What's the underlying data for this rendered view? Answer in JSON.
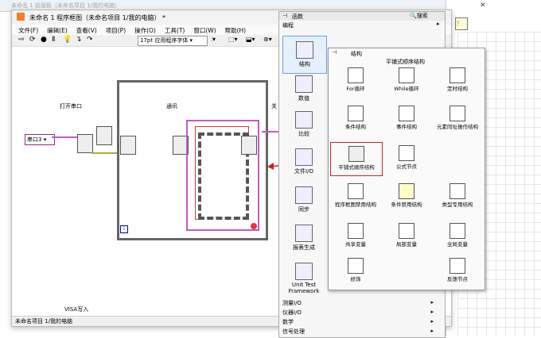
{
  "back_window": {
    "title": "未命名 1 前面板（未命名项目 1/我的电脑）"
  },
  "block_diagram": {
    "title": "未命名 1 程序框图（未命名项目 1/我的电脑） *",
    "menu": [
      "文件(F)",
      "编辑(E)",
      "查看(V)",
      "项目(P)",
      "操作(O)",
      "工具(T)",
      "窗口(W)",
      "帮助(H)"
    ],
    "font_select": "17pt 应用程序字体",
    "labels": {
      "open_port": "打开串口",
      "comm": "通讯",
      "close": "关",
      "visa_write": "VISA写入",
      "serial_const": "串口3"
    },
    "frame_index": "i",
    "status": "未命名项目 1/我的电脑"
  },
  "palette": {
    "title": "函数",
    "search": "搜索",
    "section": "编程",
    "categories": [
      "结构",
      "数值",
      "比较",
      "文件I/O",
      "同步",
      "报表生成",
      "Unit Test Framework"
    ],
    "bottom_items": [
      "测量I/O",
      "仪器I/O",
      "数学",
      "信号处理"
    ]
  },
  "sub_palette": {
    "title": "结构",
    "header": "平铺式顺序结构",
    "items": [
      "For循环",
      "While循环",
      "定时结构",
      "条件结构",
      "事件结构",
      "元素同址操作结构",
      "平铺式顺序结构",
      "公式节点",
      "",
      "程序框图禁用结构",
      "条件禁用结构",
      "类型专用结构",
      "共享变量",
      "局部变量",
      "全局变量",
      "修饰",
      "",
      "反馈节点"
    ]
  },
  "colors": {
    "accent": "#e0383a",
    "highlight": "#d02020",
    "wire_pink": "#c25ac2",
    "wire_yellow": "#a8a840"
  }
}
